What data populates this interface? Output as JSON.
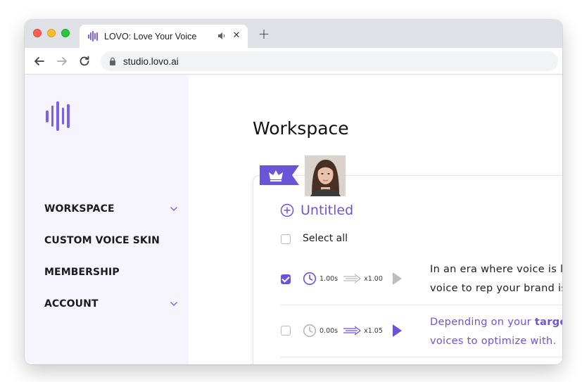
{
  "browser": {
    "tab_title": "LOVO: Love Your Voice",
    "tab_close": "✕",
    "new_tab": "+",
    "url": "studio.lovo.ai"
  },
  "sidebar": {
    "items": [
      {
        "label": "WORKSPACE",
        "has_chevron": true
      },
      {
        "label": "CUSTOM VOICE SKIN",
        "has_chevron": false
      },
      {
        "label": "MEMBERSHIP",
        "has_chevron": false
      },
      {
        "label": "ACCOUNT",
        "has_chevron": true
      }
    ]
  },
  "main": {
    "title": "Workspace",
    "project": {
      "title": "Untitled",
      "select_all_label": "Select all",
      "rows": [
        {
          "checked": true,
          "pause": "1.00s",
          "speed": "x1.00",
          "line1": "In an era where voice is l",
          "line2": "voice to rep your brand is",
          "text_style": "dark"
        },
        {
          "checked": false,
          "pause": "0.00s",
          "speed": "x1.05",
          "line1_start": "Depending on your ",
          "line1_bold": "targe",
          "line2": "voices to optimize with.",
          "text_style": "purple"
        }
      ]
    }
  },
  "colors": {
    "brand": "#6a55d9",
    "sidebar_bg": "#f6f5fe",
    "chrome_bg": "#dee1e6"
  },
  "icons": [
    "lovo-logo-icon",
    "crown-icon",
    "add-circle-icon",
    "clock-icon",
    "speed-arrows-icon",
    "play-icon",
    "chevron-down-icon",
    "lock-icon",
    "back-arrow-icon",
    "forward-arrow-icon",
    "reload-icon",
    "audio-playing-icon",
    "close-icon"
  ]
}
